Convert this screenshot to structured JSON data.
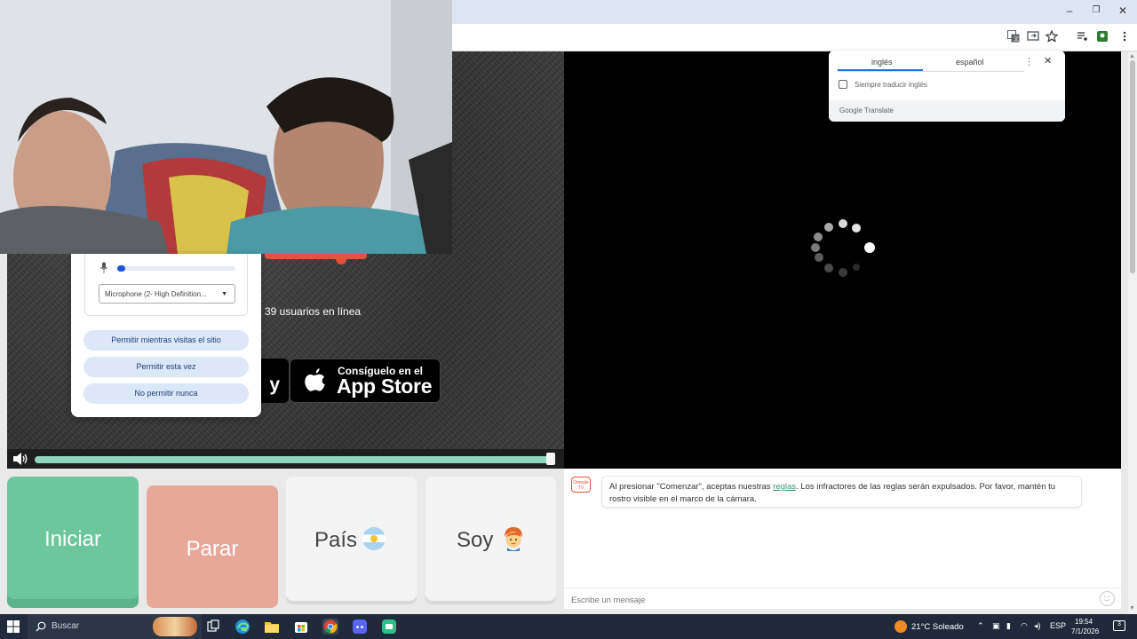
{
  "window": {
    "minimize": "–",
    "restore": "❐",
    "close": "✕"
  },
  "local": {
    "online_text": "39 usuarios en línea",
    "google_play_fragment": "y",
    "appstore_small": "Consíguelo en el",
    "appstore_big": "App Store",
    "volume_level": 1.0
  },
  "permission": {
    "mic_device": "Microphone (2- High Definition...",
    "mic_level": 0.05,
    "allow_while_visiting": "Permitir mientras visitas el sitio",
    "allow_once": "Permitir esta vez",
    "never_allow": "No permitir nunca"
  },
  "translate": {
    "tab_source": "inglés",
    "tab_target": "español",
    "always_translate": "Siempre traducir inglés",
    "brand": "Google Translate"
  },
  "controls": {
    "start": "Iniciar",
    "stop": "Parar",
    "country": "País",
    "gender": "Soy"
  },
  "chat": {
    "logo_text": "Omegle TV",
    "notice_before": "Al presionar \"Comenzar\", aceptas nuestras ",
    "notice_link": "reglas",
    "notice_after": ". Los infractores de las reglas serán expulsados. Por favor, mantén tu rostro visible en el marco de la cámara.",
    "input_placeholder": "Escribe un mensaje"
  },
  "taskbar": {
    "search_label": "Buscar",
    "weather": "21°C  Soleado",
    "language": "ESP",
    "time": "19:54",
    "date": "7/1/2026",
    "notifications": "3"
  },
  "colors": {
    "start_green": "#6cc79c",
    "stop_red": "#e8a898",
    "accent_teal": "#8fd6bd",
    "spinner_gray": "#9a9a9a"
  }
}
